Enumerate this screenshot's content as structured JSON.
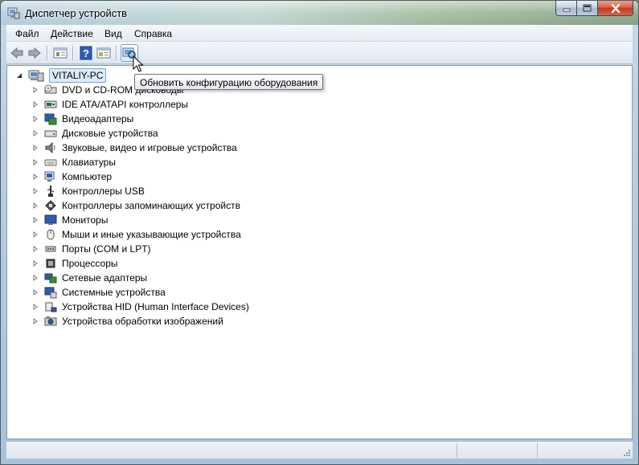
{
  "window": {
    "title": "Диспетчер устройств",
    "icon": "device-manager-icon"
  },
  "menu": {
    "items": [
      "Файл",
      "Действие",
      "Вид",
      "Справка"
    ]
  },
  "toolbar": {
    "buttons": [
      "back-arrow-icon",
      "forward-arrow-icon",
      "properties-icon",
      "help-icon",
      "view-icon",
      "scan-hardware-icon"
    ],
    "tooltip": "Обновить конфигурацию оборудования"
  },
  "tree": {
    "root": "VITALIY-PC",
    "items": [
      {
        "label": "DVD и CD-ROM дисководы",
        "icon": "dvd-drive-icon"
      },
      {
        "label": "IDE ATA/ATAPI контроллеры",
        "icon": "ide-controller-icon"
      },
      {
        "label": "Видеоадаптеры",
        "icon": "display-adapter-icon"
      },
      {
        "label": "Дисковые устройства",
        "icon": "disk-drive-icon"
      },
      {
        "label": "Звуковые, видео и игровые устройства",
        "icon": "speaker-icon"
      },
      {
        "label": "Клавиатуры",
        "icon": "keyboard-icon"
      },
      {
        "label": "Компьютер",
        "icon": "computer-icon"
      },
      {
        "label": "Контроллеры USB",
        "icon": "usb-icon"
      },
      {
        "label": "Контроллеры запоминающих устройств",
        "icon": "storage-controller-icon"
      },
      {
        "label": "Мониторы",
        "icon": "monitor-icon"
      },
      {
        "label": "Мыши и иные указывающие устройства",
        "icon": "mouse-icon"
      },
      {
        "label": "Порты (COM и LPT)",
        "icon": "port-icon"
      },
      {
        "label": "Процессоры",
        "icon": "processor-icon"
      },
      {
        "label": "Сетевые адаптеры",
        "icon": "network-adapter-icon"
      },
      {
        "label": "Системные устройства",
        "icon": "system-device-icon"
      },
      {
        "label": "Устройства HID (Human Interface Devices)",
        "icon": "hid-icon"
      },
      {
        "label": "Устройства обработки изображений",
        "icon": "camera-icon"
      }
    ]
  }
}
